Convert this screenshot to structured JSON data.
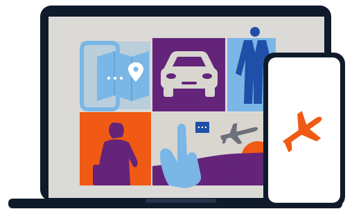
{
  "colors": {
    "device_frame": "#0f1b2a",
    "laptop_screen": "#dcdad7",
    "tile_blue": "#7ab7e6",
    "tile_purple": "#63247a",
    "tile_orange": "#f05a14",
    "tile_light": "#d9d6cf",
    "person_blue": "#1f4fa8",
    "plane_gray": "#6b7079",
    "phone_screen": "#ffffff",
    "plane_orange": "#f05a14"
  },
  "icons": {
    "map_pin": "location-pin-icon",
    "car": "car-icon",
    "person": "business-person-icon",
    "traveler": "traveler-icon",
    "hand_ticket": "hand-with-ticket-icon",
    "plane_small": "airplane-icon",
    "plane_phone": "airplane-icon"
  }
}
